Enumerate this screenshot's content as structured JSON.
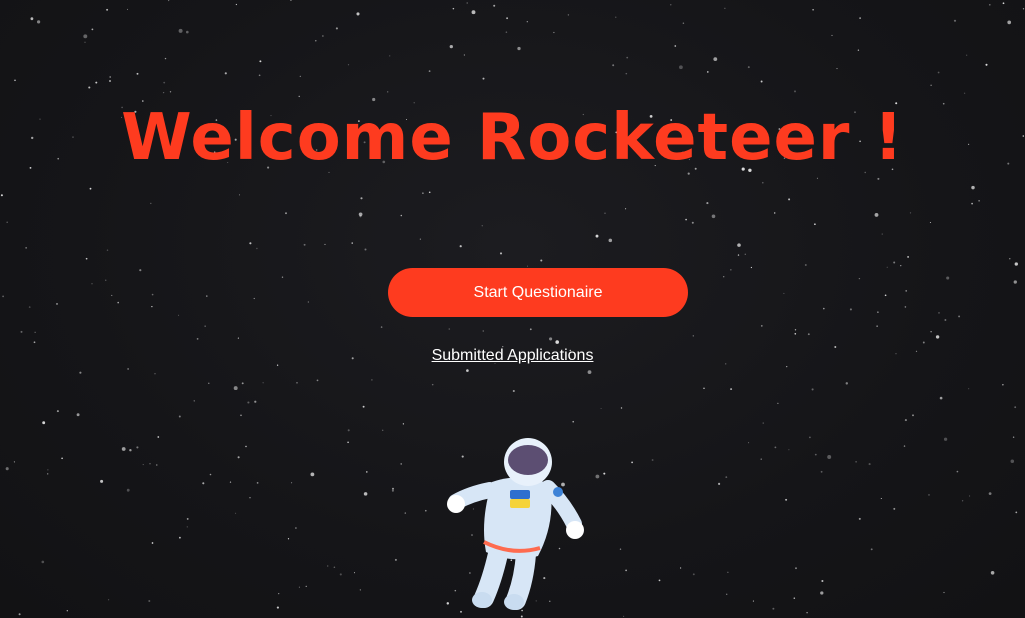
{
  "header": {
    "title": "Welcome Rocketeer !"
  },
  "actions": {
    "start_label": "Start Questionaire",
    "submitted_label": "Submitted Applications"
  },
  "illustration": {
    "icon": "astronaut-icon",
    "flag": "ukraine-flag-icon"
  },
  "colors": {
    "accent": "#fe3b1f",
    "background": "#151518",
    "text": "#ffffff"
  }
}
